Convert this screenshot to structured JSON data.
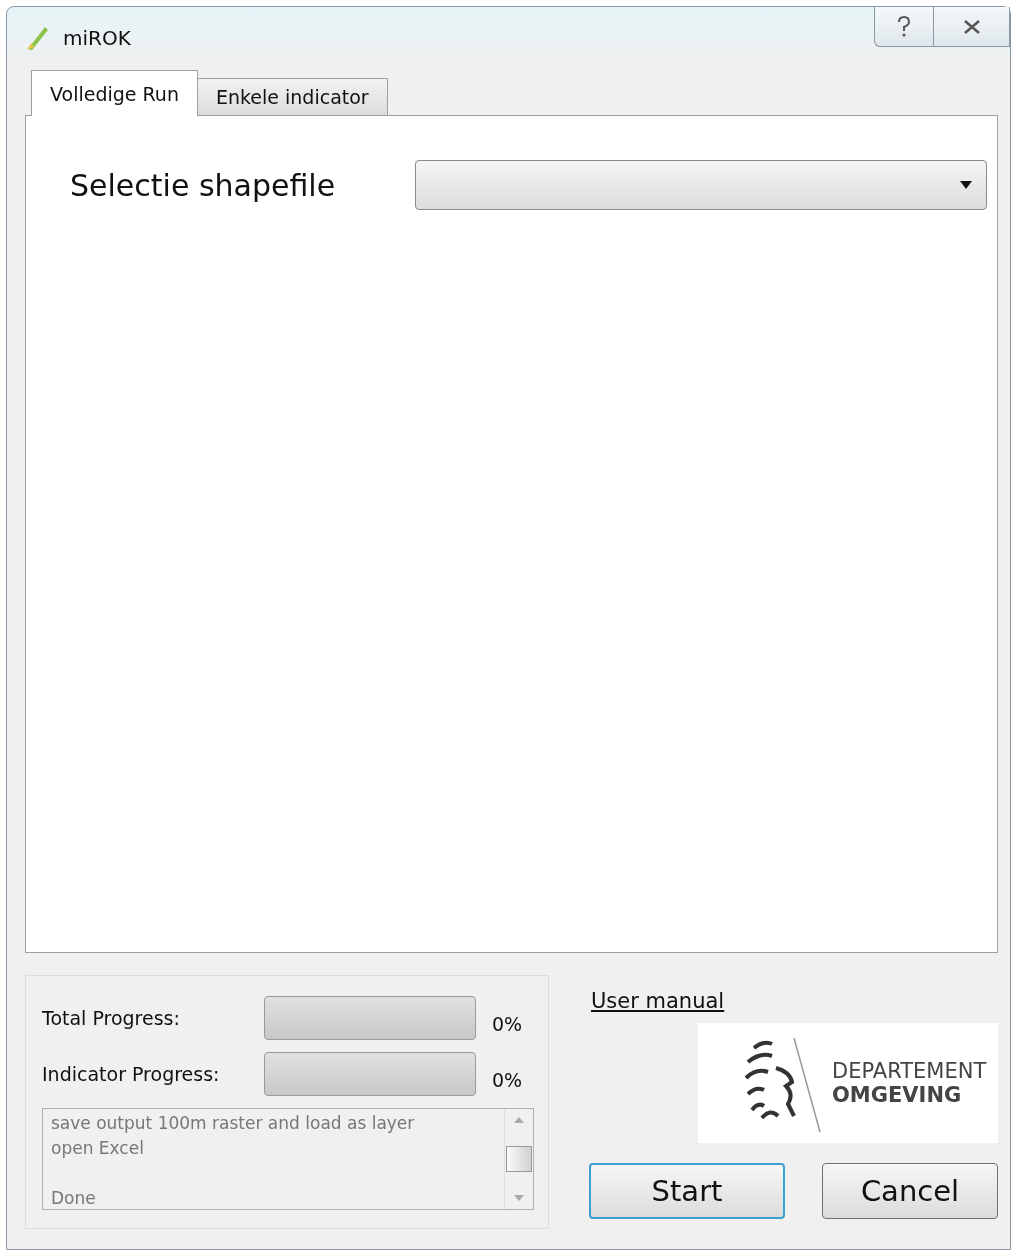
{
  "window": {
    "title": "miROK"
  },
  "tabs": [
    {
      "label": "Volledige Run",
      "selected": true
    },
    {
      "label": "Enkele indicator",
      "selected": false
    }
  ],
  "shapefile": {
    "label": "Selectie shapefile"
  },
  "progress": [
    {
      "label": "Total Progress:",
      "level": 0,
      "reading": "0%"
    },
    {
      "label": "Indicator Progress:",
      "level": 0,
      "reading": "0%"
    }
  ],
  "log": [
    {
      "text": "save output 100m raster and load as layer",
      "gap_before": false
    },
    {
      "text": "open Excel",
      "gap_before": false
    },
    {
      "text": "Done",
      "gap_before": true
    }
  ],
  "user_manual": "User manual",
  "logo": {
    "line_1": "DEPARTEMENT",
    "line_2": "OMGEVING"
  },
  "buttons": [
    {
      "label": "Start",
      "default": true
    },
    {
      "label": "Cancel",
      "default": false
    }
  ]
}
